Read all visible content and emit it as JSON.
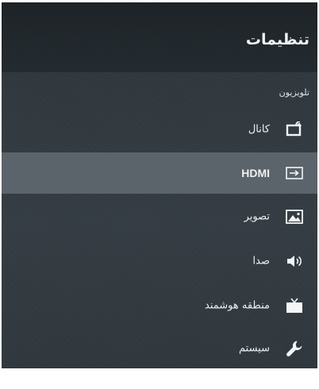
{
  "header": {
    "title": "تنظیمات"
  },
  "section": {
    "label": "تلویزیون"
  },
  "menu": {
    "items": [
      {
        "label": "کانال",
        "icon": "channel-icon",
        "selected": false
      },
      {
        "label": "HDMI",
        "icon": "hdmi-input-icon",
        "selected": true
      },
      {
        "label": "تصویر",
        "icon": "picture-icon",
        "selected": false
      },
      {
        "label": "صدا",
        "icon": "speaker-icon",
        "selected": false
      },
      {
        "label": "منطقه هوشمند",
        "icon": "smart-tv-icon",
        "selected": false
      },
      {
        "label": "سیستم",
        "icon": "wrench-icon",
        "selected": false
      }
    ]
  },
  "colors": {
    "panel_background": "#323a41",
    "header_background": "#1f2529",
    "selected_row": "#5b636b",
    "text": "#eef1f3"
  }
}
